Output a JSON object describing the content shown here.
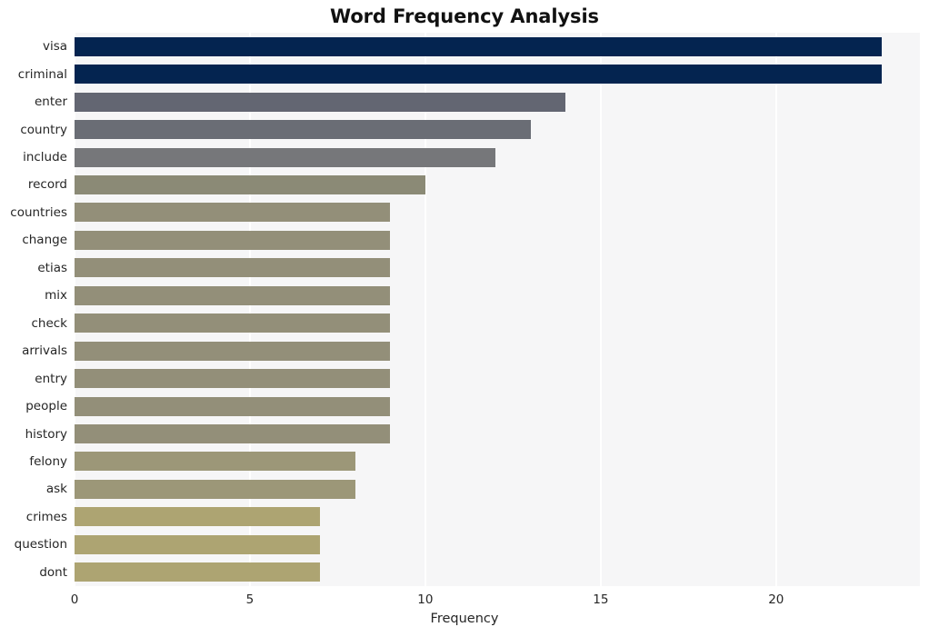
{
  "chart_data": {
    "type": "bar",
    "orientation": "horizontal",
    "title": "Word Frequency Analysis",
    "xlabel": "Frequency",
    "ylabel": "",
    "categories": [
      "visa",
      "criminal",
      "enter",
      "country",
      "include",
      "record",
      "countries",
      "change",
      "etias",
      "mix",
      "check",
      "arrivals",
      "entry",
      "people",
      "history",
      "felony",
      "ask",
      "crimes",
      "question",
      "dont"
    ],
    "values": [
      23,
      23,
      14,
      13,
      12,
      10,
      9,
      9,
      9,
      9,
      9,
      9,
      9,
      9,
      9,
      8,
      8,
      7,
      7,
      7
    ],
    "bar_colors": [
      "#042450",
      "#042450",
      "#636672",
      "#6a6d75",
      "#76777a",
      "#8b8a76",
      "#938f79",
      "#938f79",
      "#938f79",
      "#938f79",
      "#938f79",
      "#938f79",
      "#938f79",
      "#938f79",
      "#938f79",
      "#9c9778",
      "#9c9778",
      "#ada472",
      "#ada472",
      "#ada472"
    ],
    "xlim": [
      0,
      24.1
    ],
    "xticks": [
      0,
      5,
      10,
      15,
      20
    ],
    "xtick_labels": [
      "0",
      "5",
      "10",
      "15",
      "20"
    ],
    "grid": true,
    "grid_color": "#ffffff",
    "plot_background": "#f6f6f7",
    "figure_background": "#ffffff",
    "legend": null
  },
  "figure": {
    "title": "Word Frequency Analysis",
    "axis_label_x": "Frequency"
  }
}
